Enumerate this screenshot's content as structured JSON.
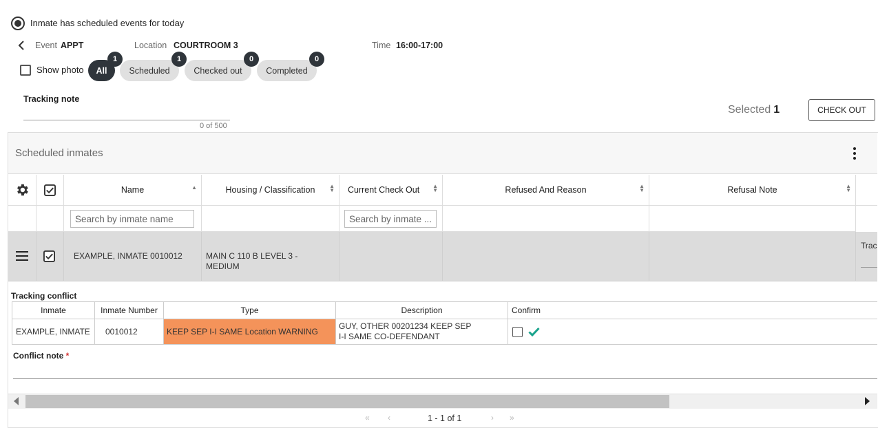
{
  "header": {
    "radio_label": "Inmate has scheduled events for today",
    "event_label": "Event",
    "event_value": "APPT",
    "location_label": "Location",
    "location_value": "COURTROOM 3",
    "time_label": "Time",
    "time_value": "16:00-17:00"
  },
  "filters": {
    "show_photo_label": "Show photo",
    "chips": [
      {
        "label": "All",
        "count": "1",
        "active": true
      },
      {
        "label": "Scheduled",
        "count": "1",
        "active": false
      },
      {
        "label": "Checked out",
        "count": "0",
        "active": false
      },
      {
        "label": "Completed",
        "count": "0",
        "active": false
      }
    ]
  },
  "tracking_note": {
    "label": "Tracking note",
    "counter": "0 of 500"
  },
  "selection": {
    "selected_label": "Selected",
    "selected_count": "1",
    "checkout_button": "CHECK OUT"
  },
  "grid": {
    "title": "Scheduled inmates",
    "columns": [
      "Name",
      "Housing / Classification",
      "Current Check Out",
      "Refused And Reason",
      "Refusal Note"
    ],
    "filter_placeholders": {
      "name": "Search by inmate name",
      "checkout": "Search by inmate ..."
    },
    "rows": [
      {
        "name": "EXAMPLE, INMATE 0010012",
        "housing": "MAIN C 110 B LEVEL 3 - MEDIUM",
        "extra_partial": "Trac"
      }
    ]
  },
  "conflict": {
    "title": "Tracking conflict",
    "headers": [
      "Inmate",
      "Inmate Number",
      "Type",
      "Description",
      "Confirm"
    ],
    "row": {
      "inmate": "EXAMPLE, INMATE",
      "number": "0010012",
      "type": "KEEP SEP I-I SAME Location WARNING",
      "description": "GUY, OTHER 00201234   KEEP SEP I-I SAME CO-DEFENDANT"
    },
    "note_label": "Conflict note",
    "required_mark": "*",
    "type_color": "#f4935a",
    "confirm_color": "#1aa38c"
  },
  "pager": {
    "text": "1 - 1 of 1"
  },
  "icons": [
    "back-chevron-icon",
    "gear-icon",
    "menu-icon",
    "kebab-icon",
    "check-icon",
    "first-page-icon",
    "prev-page-icon",
    "next-page-icon",
    "last-page-icon"
  ]
}
